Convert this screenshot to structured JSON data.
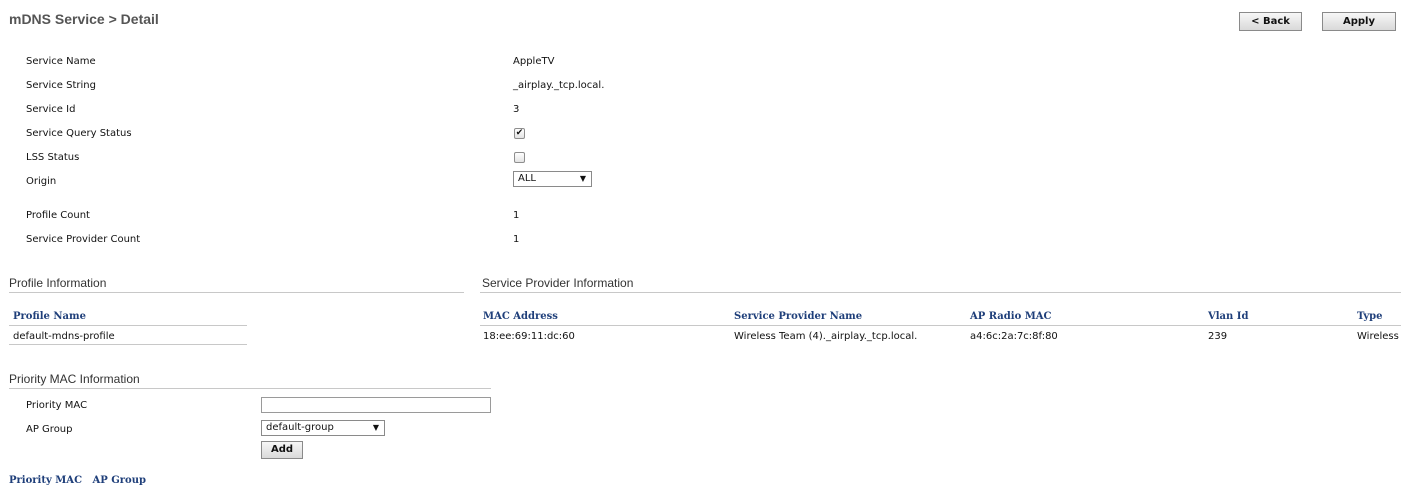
{
  "page": {
    "title": "mDNS Service > Detail"
  },
  "toolbar": {
    "back_label": "< Back",
    "apply_label": "Apply"
  },
  "service": {
    "name_label": "Service Name",
    "name_value": "AppleTV",
    "string_label": "Service String",
    "string_value": "_airplay._tcp.local.",
    "id_label": "Service Id",
    "id_value": "3",
    "query_status_label": "Service Query Status",
    "query_status_checked": true,
    "query_status_glyph": "✔",
    "lss_status_label": "LSS Status",
    "lss_status_checked": false,
    "origin_label": "Origin",
    "origin_value": "ALL",
    "profile_count_label": "Profile Count",
    "profile_count_value": "1",
    "provider_count_label": "Service Provider Count",
    "provider_count_value": "1"
  },
  "profile_info": {
    "title": "Profile Information",
    "column": "Profile Name",
    "rows": [
      "default-mdns-profile"
    ]
  },
  "provider_info": {
    "title": "Service Provider Information",
    "columns": [
      "MAC Address",
      "Service Provider Name",
      "AP Radio MAC",
      "Vlan Id",
      "Type"
    ],
    "rows": [
      [
        "18:ee:69:11:dc:60",
        "Wireless Team (4)._airplay._tcp.local.",
        "a4:6c:2a:7c:8f:80",
        "239",
        "Wireless"
      ]
    ]
  },
  "priority_mac": {
    "title": "Priority MAC Information",
    "mac_label": "Priority MAC",
    "mac_value": "",
    "ap_group_label": "AP Group",
    "ap_group_value": "default-group",
    "add_label": "Add"
  },
  "bottom_links": {
    "priority_mac": "Priority MAC",
    "ap_group": "AP Group"
  },
  "icons": {
    "dropdown": "chevron-down-icon",
    "check": "checkmark-icon"
  },
  "colors": {
    "header_blue": "#1f3f7a",
    "title_gray": "#555555",
    "section_gray": "#333333"
  }
}
